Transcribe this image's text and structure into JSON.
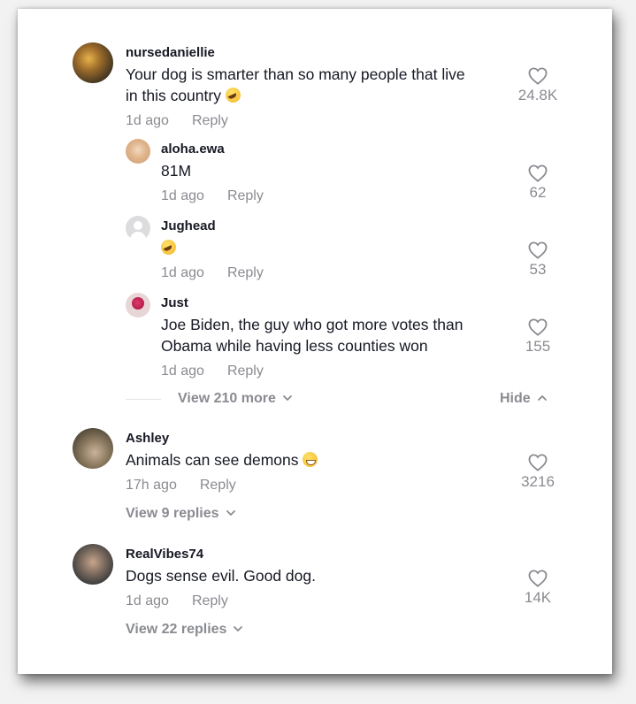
{
  "comments": [
    {
      "username": "nursedaniellie",
      "text_line1": "Your dog is smarter than so many people that live",
      "text_line2": "in this country",
      "emoji": "rolling-on-floor-laughing",
      "time": "1d ago",
      "reply_label": "Reply",
      "likes": "24.8K",
      "replies": [
        {
          "username": "aloha.ewa",
          "text": "81M",
          "time": "1d ago",
          "reply_label": "Reply",
          "likes": "62"
        },
        {
          "username": "Jughead",
          "emoji": "rolling-on-floor-laughing",
          "time": "1d ago",
          "reply_label": "Reply",
          "likes": "53"
        },
        {
          "username": "Just",
          "text_line1": "Joe Biden, the guy who got more votes than",
          "text_line2": "Obama while having less counties won",
          "time": "1d ago",
          "reply_label": "Reply",
          "likes": "155"
        }
      ],
      "view_more_label": "View 210 more",
      "hide_label": "Hide"
    },
    {
      "username": "Ashley",
      "text": "Animals can see demons",
      "emoji": "grinning-face",
      "time": "17h ago",
      "reply_label": "Reply",
      "likes": "3216",
      "view_replies_label": "View 9 replies"
    },
    {
      "username": "RealVibes74",
      "text": "Dogs sense evil. Good dog.",
      "time": "1d ago",
      "reply_label": "Reply",
      "likes": "14K",
      "view_replies_label": "View 22 replies"
    }
  ],
  "icons": {
    "like": "heart-outline-icon",
    "expand": "chevron-down-icon",
    "collapse": "chevron-up-icon"
  }
}
